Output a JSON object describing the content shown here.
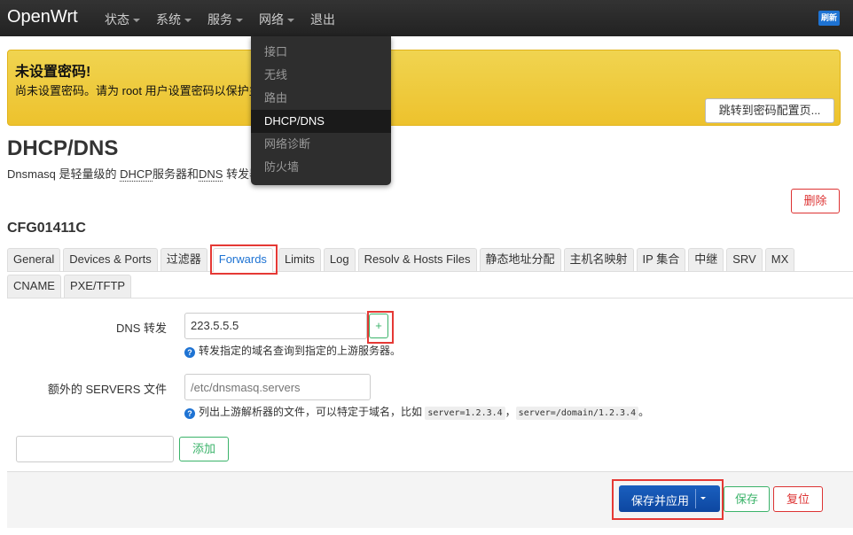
{
  "nav": {
    "brand": "OpenWrt",
    "items": [
      "状态",
      "系统",
      "服务",
      "网络",
      "退出"
    ],
    "refresh": "刷新"
  },
  "alert": {
    "title": "未设置密码!",
    "text": "尚未设置密码。请为 root 用户设置密码以保护主",
    "button": "跳转到密码配置页..."
  },
  "network_menu": {
    "items": [
      "接口",
      "无线",
      "路由",
      "DHCP/DNS",
      "网络诊断",
      "防火墙"
    ],
    "active": "DHCP/DNS"
  },
  "page": {
    "title": "DHCP/DNS",
    "desc_pre": "Dnsmasq 是轻量级的 ",
    "desc_dhcp": "DHCP",
    "desc_mid": "服务器和",
    "desc_dns": "DNS",
    "desc_post": " 转发器"
  },
  "section": {
    "name": "CFG01411C",
    "delete": "删除"
  },
  "tabs": {
    "row1": [
      "General",
      "Devices & Ports",
      "过滤器",
      "Forwards",
      "Limits",
      "Log",
      "Resolv & Hosts Files",
      "静态地址分配",
      "主机名映射",
      "IP 集合",
      "中继",
      "SRV",
      "MX"
    ],
    "row2": [
      "CNAME",
      "PXE/TFTP"
    ],
    "active": "Forwards"
  },
  "form": {
    "dns_forward": {
      "label": "DNS 转发",
      "value": "223.5.5.5",
      "add": "+",
      "help": "转发指定的域名查询到指定的上游服务器。"
    },
    "servers_file": {
      "label": "额外的 SERVERS 文件",
      "placeholder": "/etc/dnsmasq.servers",
      "help": "列出上游解析器的文件，可以特定于域名，比如",
      "code1": "server=1.2.3.4",
      "sep": "，",
      "code2": "server=/domain/1.2.3.4",
      "end": "。"
    },
    "add_section": {
      "value": "",
      "button": "添加"
    }
  },
  "footer": {
    "save_apply": "保存并应用",
    "save": "保存",
    "reset": "复位"
  },
  "colors": {
    "accent": "#1e73d3",
    "warning": "#edc22d",
    "success": "#3bb36a",
    "danger": "#dd3333",
    "highlight": "#e53935"
  }
}
